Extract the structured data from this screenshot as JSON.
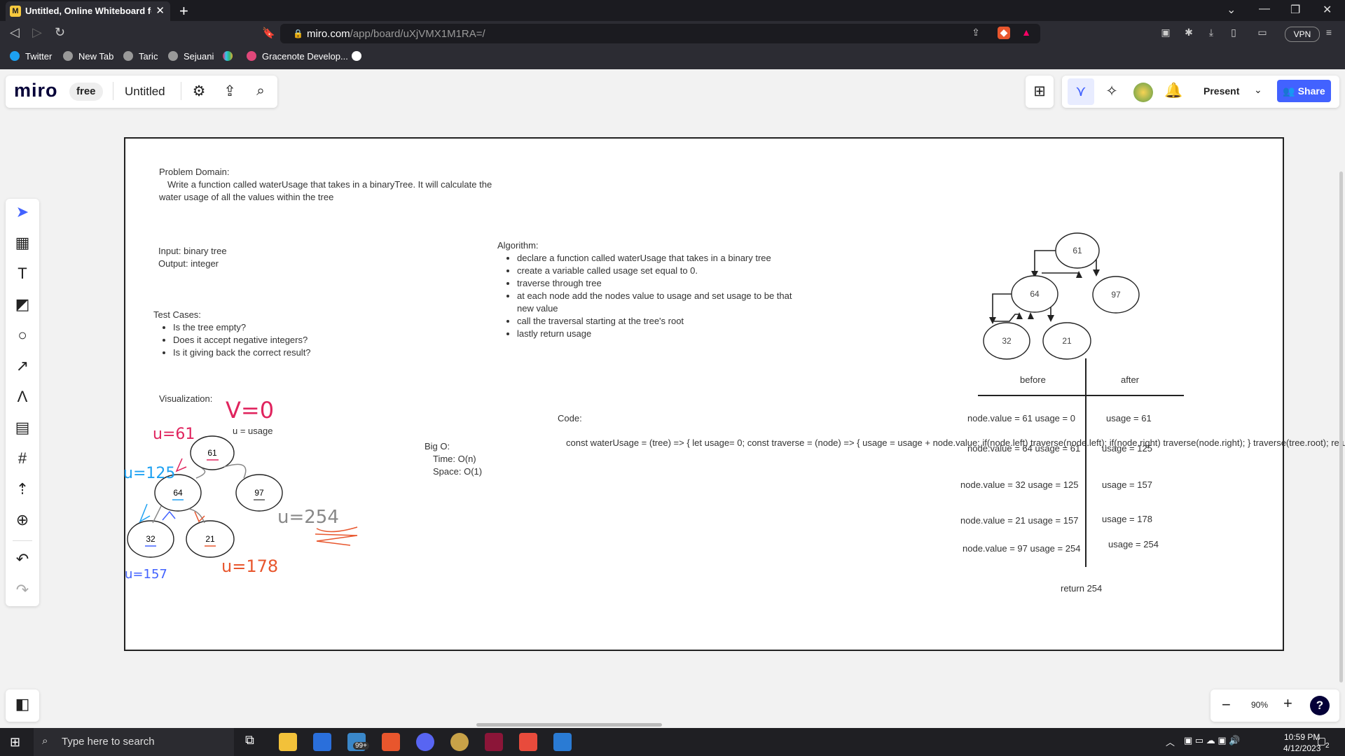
{
  "browser": {
    "tab_title": "Untitled, Online Whiteboard for V",
    "url_host": "miro.com",
    "url_path": "/app/board/uXjVMX1M1RA=/",
    "vpn_label": "VPN",
    "bookmarks": [
      "Twitter",
      "New Tab",
      "Taric",
      "Sejuani",
      "Gracenote Develop..."
    ]
  },
  "miro": {
    "logo": "miro",
    "plan": "free",
    "board_name": "Untitled",
    "present_label": "Present",
    "share_label": "Share",
    "zoom_level": "90%",
    "help_label": "?"
  },
  "board": {
    "problem_title": "Problem Domain:",
    "problem_line1": "Write a function called waterUsage that takes in a binaryTree. It will calculate the",
    "problem_line2": "water usage of all the values within the tree",
    "input": "Input: binary tree",
    "output": "Output: integer",
    "test_cases_title": "Test Cases:",
    "test_cases": [
      "Is the tree empty?",
      "Does it accept negative integers?",
      "Is it giving back the correct result?"
    ],
    "algorithm_title": "Algorithm:",
    "algorithm": [
      "declare a function called waterUsage that takes in a binary tree",
      "create a variable called usage set equal to 0.",
      "traverse through tree",
      "at each node add the nodes value to usage and set usage to be that",
      "new value",
      "call the traversal starting at the tree's root",
      "lastly return usage"
    ],
    "visualization_title": "Visualization:",
    "u_legend": "u = usage",
    "big_o_title": "Big O:",
    "big_o_time": "Time: O(n)",
    "big_o_space": "Space: O(1)",
    "code_title": "Code:",
    "code_lines": [
      "const waterUsage = (tree) => {",
      "  let usage= 0;",
      "",
      "  const traverse = (node) => {",
      "    usage = usage + node.value;",
      "",
      "",
      "    if(node.left) traverse(node.left);",
      "    if(node.right) traverse(node.right);",
      "  }",
      "  traverse(tree.root);",
      "  return usage;",
      "}"
    ],
    "tree_nodes": [
      "61",
      "64",
      "97",
      "32",
      "21"
    ],
    "table_before": "before",
    "table_after": "after",
    "table_rows": [
      {
        "before": "node.value = 61 usage = 0",
        "after": "usage = 61"
      },
      {
        "before": "node.value = 64 usage = 61",
        "after": "usage = 125"
      },
      {
        "before": "node.value = 32  usage = 125",
        "after": "usage = 157"
      },
      {
        "before": "node.value = 21  usage = 157",
        "after": "usage = 178"
      },
      {
        "before": "node.value = 97 usage = 254",
        "after": "usage = 254"
      }
    ],
    "return_text": "return 254",
    "hand_v0": "V=0",
    "hand_u61": "u=61",
    "hand_u125": "u=125",
    "hand_u157": "u=157",
    "hand_u178": "u=178",
    "hand_u254": "u=254"
  },
  "taskbar": {
    "search_placeholder": "Type here to search",
    "badge": "99+",
    "time": "10:59 PM",
    "date": "4/12/2023",
    "notif": "2"
  }
}
